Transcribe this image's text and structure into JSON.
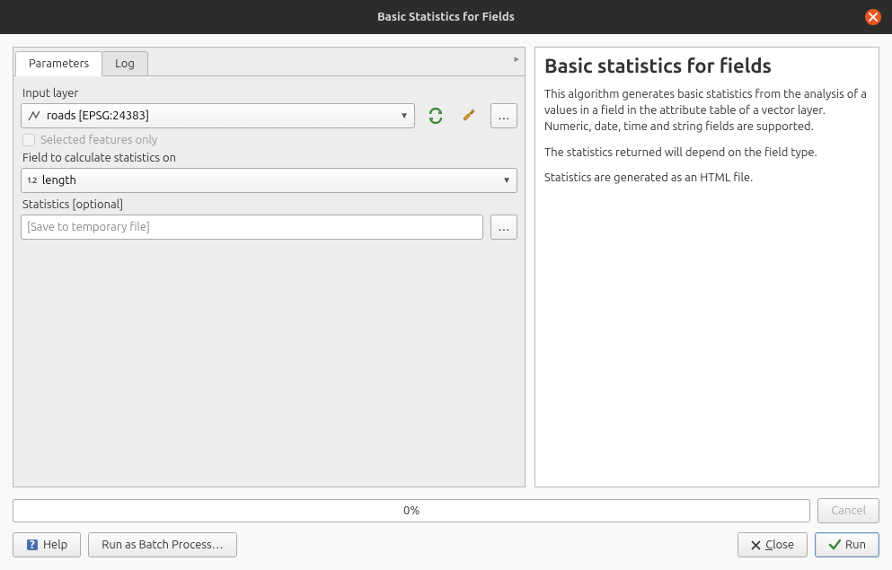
{
  "title": "Basic Statistics for Fields",
  "tabs": {
    "parameters": "Parameters",
    "log": "Log"
  },
  "form": {
    "input_layer_label": "Input layer",
    "input_layer_value": "roads [EPSG:24383]",
    "selected_only_label": "Selected features only",
    "field_label": "Field to calculate statistics on",
    "field_value": "length",
    "stats_label": "Statistics [optional]",
    "stats_placeholder": "[Save to temporary file]"
  },
  "help": {
    "heading": "Basic statistics for fields",
    "p1": "This algorithm generates basic statistics from the analysis of a values in a field in the attribute table of a vector layer. Numeric, date, time and string fields are supported.",
    "p2": "The statistics returned will depend on the field type.",
    "p3": "Statistics are generated as an HTML file."
  },
  "progress": {
    "text": "0%"
  },
  "buttons": {
    "cancel": "Cancel",
    "help": "Help",
    "batch": "Run as Batch Process…",
    "close": "Close",
    "run": "Run"
  },
  "icons": {
    "ellipsis": "…"
  }
}
